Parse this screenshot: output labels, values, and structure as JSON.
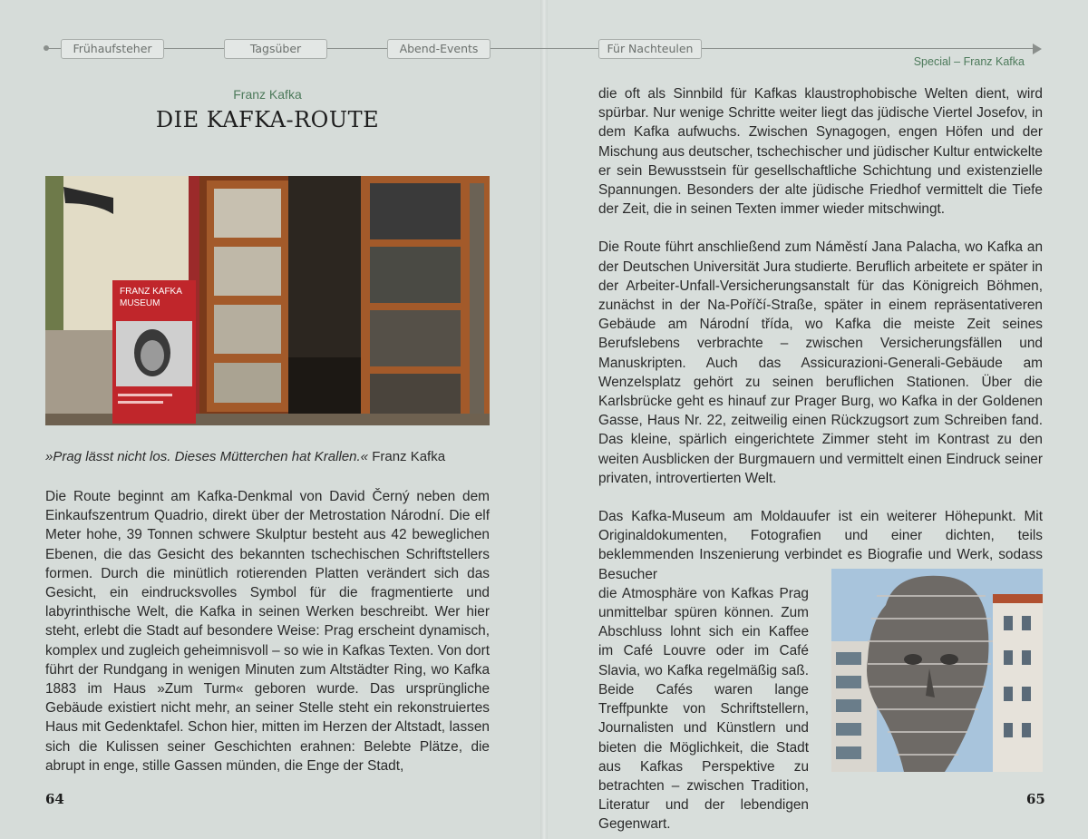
{
  "timeline": {
    "tags": [
      "Frühaufsteher",
      "Tagsüber",
      "Abend-Events",
      "Für Nachteulen"
    ]
  },
  "header": {
    "special": "Special – Franz Kafka"
  },
  "left": {
    "kicker": "Franz Kafka",
    "title": "DIE KAFKA-ROUTE",
    "photo_sign": {
      "line1": "FRANZ KAFKA",
      "line2": "MUSEUM"
    },
    "quote_text": "»Prag lässt nicht los. Dieses Mütterchen hat Krallen.«",
    "quote_author": "Franz Kafka",
    "paragraph": "Die Route beginnt am Kafka-Denkmal von David Černý neben dem Einkaufszentrum Quadrio, direkt über der Metrostation Národní. Die elf Meter hohe, 39 Tonnen schwere Skulptur besteht aus 42 beweglichen Ebenen, die das Gesicht des bekannten tschechischen Schriftstellers formen. Durch die minütlich rotierenden Platten verändert sich das Gesicht, ein eindrucksvolles Symbol für die fragmentierte und labyrinthische Welt, die Kafka in seinen Werken beschreibt. Wer hier steht, erlebt die Stadt auf besondere Weise: Prag erscheint dynamisch, komplex und zugleich geheimnisvoll – so wie in Kafkas Texten. Von dort führt der Rundgang in wenigen Minuten zum Altstädter Ring, wo Kafka 1883 im Haus »Zum Turm« geboren wurde. Das ursprüngliche Gebäude existiert nicht mehr, an seiner Stelle steht ein rekonstruiertes Haus mit Gedenktafel. Schon hier, mitten im Herzen der Altstadt, lassen sich die Kulissen seiner Geschichten erahnen: Belebte Plätze, die abrupt in enge, stille Gassen münden, die Enge der Stadt,",
    "page_number": "64"
  },
  "right": {
    "paragraph1": "die oft als Sinnbild für Kafkas klaustrophobische Welten dient, wird spürbar. Nur wenige Schritte weiter liegt das jüdische Viertel Josefov, in dem Kafka aufwuchs. Zwischen Synagogen, engen Höfen und der Mischung aus deutscher, tschechischer und jüdischer Kultur entwickelte er sein Bewusstsein für gesellschaftliche Schichtung und existenzielle Spannungen. Besonders der alte jüdische Friedhof vermittelt die Tiefe der Zeit, die in seinen Texten immer wieder mitschwingt.",
    "paragraph2": "Die Route führt anschließend zum Náměstí Jana Palacha, wo Kafka an der Deutschen Universität Jura studierte. Beruflich arbeitete er später in der Arbeiter-Unfall-Versicherungsanstalt für das Königreich Böhmen, zunächst in der Na-Poříčí-Straße, später in einem repräsentativeren Gebäude am Národní třída, wo Kafka die meiste Zeit seines Berufslebens verbrachte – zwischen Versicherungsfällen und Manuskripten. Auch das Assicurazioni-Generali-Gebäude am Wenzelsplatz gehört zu seinen beruflichen Stationen. Über die Karlsbrücke geht es hinauf zur Prager Burg, wo Kafka in der Goldenen Gasse, Haus Nr. 22, zeitweilig einen Rückzugsort zum Schreiben fand. Das kleine, spärlich eingerichtete Zimmer steht im Kontrast zu den weiten Ausblicken der Burgmauern und vermittelt einen Eindruck seiner privaten, introvertierten Welt.",
    "paragraph3_full": "Das Kafka-Museum am Moldauufer ist ein weiterer Höhepunkt. Mit Originaldokumenten, Fotografien und einer dichten, teils beklemmenden Inszenierung verbindet es Biografie und Werk, sodass Besucher",
    "paragraph3_narrow": "die Atmosphäre von Kafkas Prag unmittelbar spüren können. Zum Abschluss lohnt sich ein Kaffee im Café Louvre oder im Café Slavia, wo Kafka regelmäßig saß. Beide Cafés waren lange Treffpunkte von Schriftstellern, Journalisten und Künstlern und bieten die Möglichkeit, die Stadt aus Kafkas Perspektive zu betrachten – zwischen Tradition, Literatur und der lebendigen Gegenwart.",
    "page_number": "65"
  }
}
